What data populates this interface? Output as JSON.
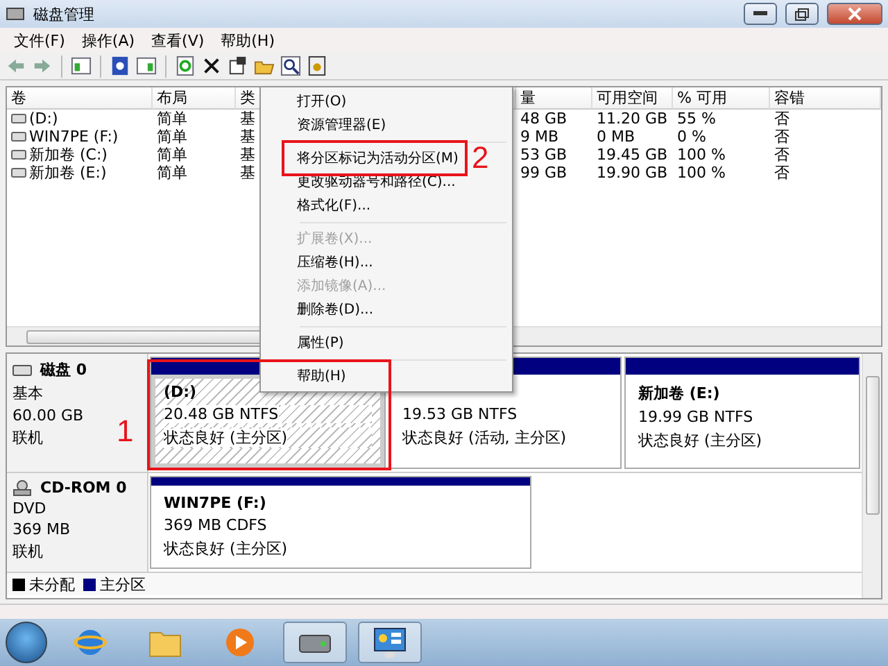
{
  "window": {
    "title": "磁盘管理"
  },
  "menu_bar": [
    "文件(F)",
    "操作(A)",
    "查看(V)",
    "帮助(H)"
  ],
  "volume_table": {
    "columns": [
      "卷",
      "布局",
      "类",
      "量",
      "可用空间",
      "% 可用",
      "容错"
    ],
    "rows": [
      [
        "(D:)",
        "简单",
        "基",
        "48 GB",
        "11.20 GB",
        "55 %",
        "否"
      ],
      [
        "WIN7PE (F:)",
        "简单",
        "基",
        "9 MB",
        "0 MB",
        "0 %",
        "否"
      ],
      [
        "新加卷 (C:)",
        "简单",
        "基",
        "53 GB",
        "19.45 GB",
        "100 %",
        "否"
      ],
      [
        "新加卷 (E:)",
        "简单",
        "基",
        "99 GB",
        "19.90 GB",
        "100 %",
        "否"
      ]
    ]
  },
  "disks": [
    {
      "name": "磁盘 0",
      "kind": "disk",
      "lines": [
        "基本",
        "60.00 GB",
        "联机"
      ],
      "partitions": [
        {
          "title": "(D:)",
          "size": "20.48 GB NTFS",
          "status": "状态良好 (主分区)",
          "selected": true
        },
        {
          "size": "19.53 GB NTFS",
          "status": "状态良好 (活动, 主分区)",
          "selected": false
        },
        {
          "title": "新加卷  (E:)",
          "size": "19.99 GB NTFS",
          "status": "状态良好 (主分区)",
          "selected": false
        }
      ]
    },
    {
      "name": "CD-ROM 0",
      "kind": "cdrom",
      "lines": [
        "DVD",
        "369 MB",
        "联机"
      ],
      "partitions": [
        {
          "title": "WIN7PE  (F:)",
          "size": "369 MB CDFS",
          "status": "状态良好 (主分区)",
          "selected": false
        }
      ]
    }
  ],
  "legend": [
    {
      "label": "未分配",
      "color": "#000000"
    },
    {
      "label": "主分区",
      "color": "#000080"
    }
  ],
  "context_menu": [
    {
      "kind": "item",
      "label": "打开(O)",
      "disabled": false
    },
    {
      "kind": "item",
      "label": "资源管理器(E)",
      "disabled": false
    },
    {
      "kind": "separator"
    },
    {
      "kind": "item",
      "label": "将分区标记为活动分区(M)",
      "disabled": false
    },
    {
      "kind": "item",
      "label": "更改驱动器号和路径(C)...",
      "disabled": false
    },
    {
      "kind": "item",
      "label": "格式化(F)...",
      "disabled": false
    },
    {
      "kind": "separator"
    },
    {
      "kind": "item",
      "label": "扩展卷(X)...",
      "disabled": true
    },
    {
      "kind": "item",
      "label": "压缩卷(H)...",
      "disabled": false
    },
    {
      "kind": "item",
      "label": "添加镜像(A)...",
      "disabled": true
    },
    {
      "kind": "item",
      "label": "删除卷(D)...",
      "disabled": false
    },
    {
      "kind": "separator"
    },
    {
      "kind": "item",
      "label": "属性(P)",
      "disabled": false
    },
    {
      "kind": "separator"
    },
    {
      "kind": "item",
      "label": "帮助(H)",
      "disabled": false
    }
  ],
  "annotations": [
    {
      "number": "1"
    },
    {
      "number": "2"
    }
  ],
  "taskbar": [
    {
      "kind": "ie",
      "active": false
    },
    {
      "kind": "folder",
      "active": false
    },
    {
      "kind": "media",
      "active": false
    },
    {
      "kind": "disk",
      "active": true
    },
    {
      "kind": "panel",
      "active": true
    }
  ]
}
